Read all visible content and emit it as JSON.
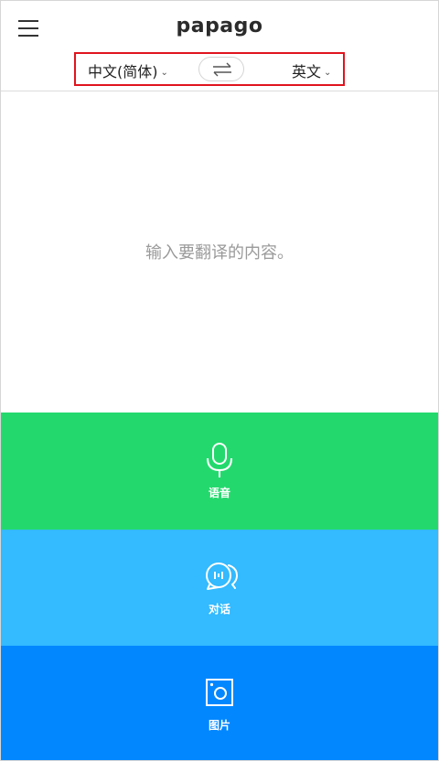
{
  "header": {
    "logo": "papago",
    "source_language": "中文(简体)",
    "target_language": "英文",
    "chevron": "⌄"
  },
  "input": {
    "placeholder": "输入要翻译的内容。"
  },
  "actions": {
    "voice_label": "语音",
    "conversation_label": "对话",
    "image_label": "图片"
  },
  "colors": {
    "voice": "#23d96d",
    "conversation": "#33baff",
    "image": "#0387ff",
    "highlight_border": "#e0141e"
  }
}
